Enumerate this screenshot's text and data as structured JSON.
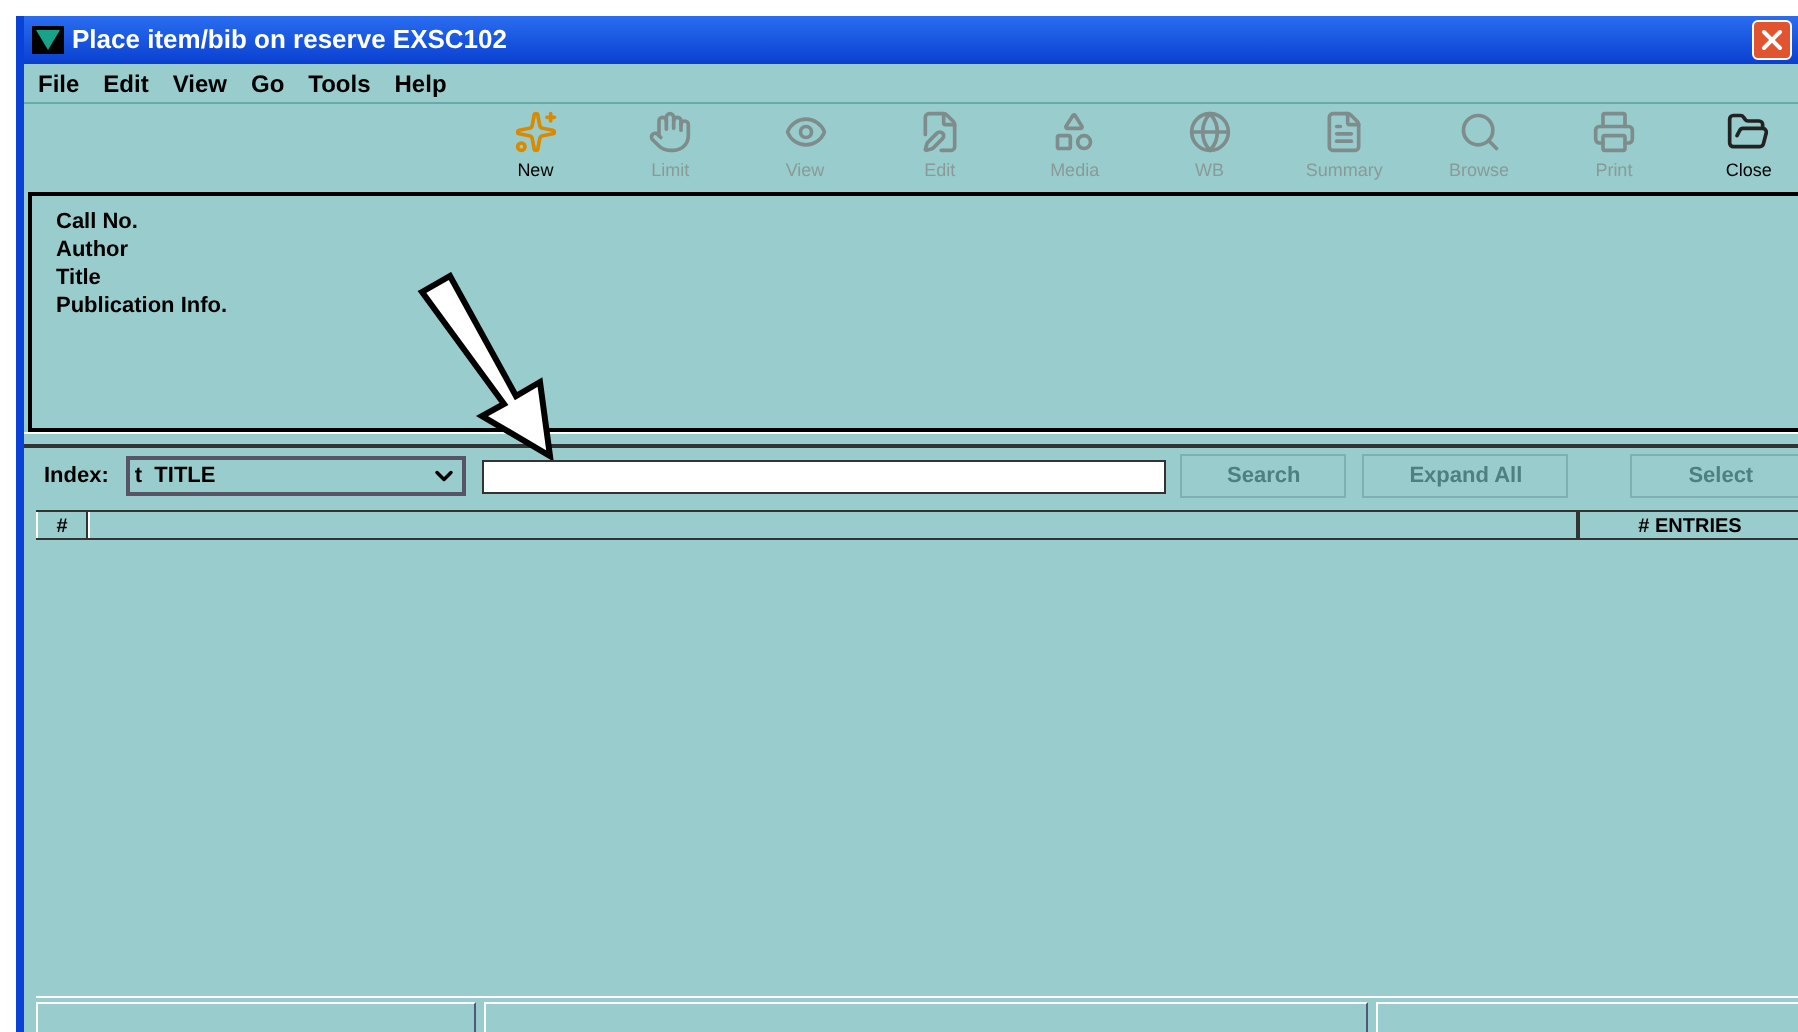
{
  "window": {
    "title": "Place item/bib on reserve EXSC102"
  },
  "menu": [
    "File",
    "Edit",
    "View",
    "Go",
    "Tools",
    "Help"
  ],
  "toolbar": [
    {
      "label": "New",
      "disabled": false
    },
    {
      "label": "Limit",
      "disabled": true
    },
    {
      "label": "View",
      "disabled": true
    },
    {
      "label": "Edit",
      "disabled": true
    },
    {
      "label": "Media",
      "disabled": true
    },
    {
      "label": "WB",
      "disabled": true
    },
    {
      "label": "Summary",
      "disabled": true
    },
    {
      "label": "Browse",
      "disabled": true
    },
    {
      "label": "Print",
      "disabled": true
    },
    {
      "label": "Close",
      "disabled": false
    }
  ],
  "details": [
    "Call No.",
    "Author",
    "Title",
    "Publication Info."
  ],
  "index": {
    "label": "Index:",
    "value": "t  TITLE"
  },
  "buttons": [
    {
      "label": "Search",
      "disabled": true
    },
    {
      "label": "Expand All",
      "disabled": true
    },
    {
      "label": "Select",
      "disabled": true
    }
  ],
  "table": {
    "columns": [
      "#",
      "# ENTRIES"
    ]
  }
}
